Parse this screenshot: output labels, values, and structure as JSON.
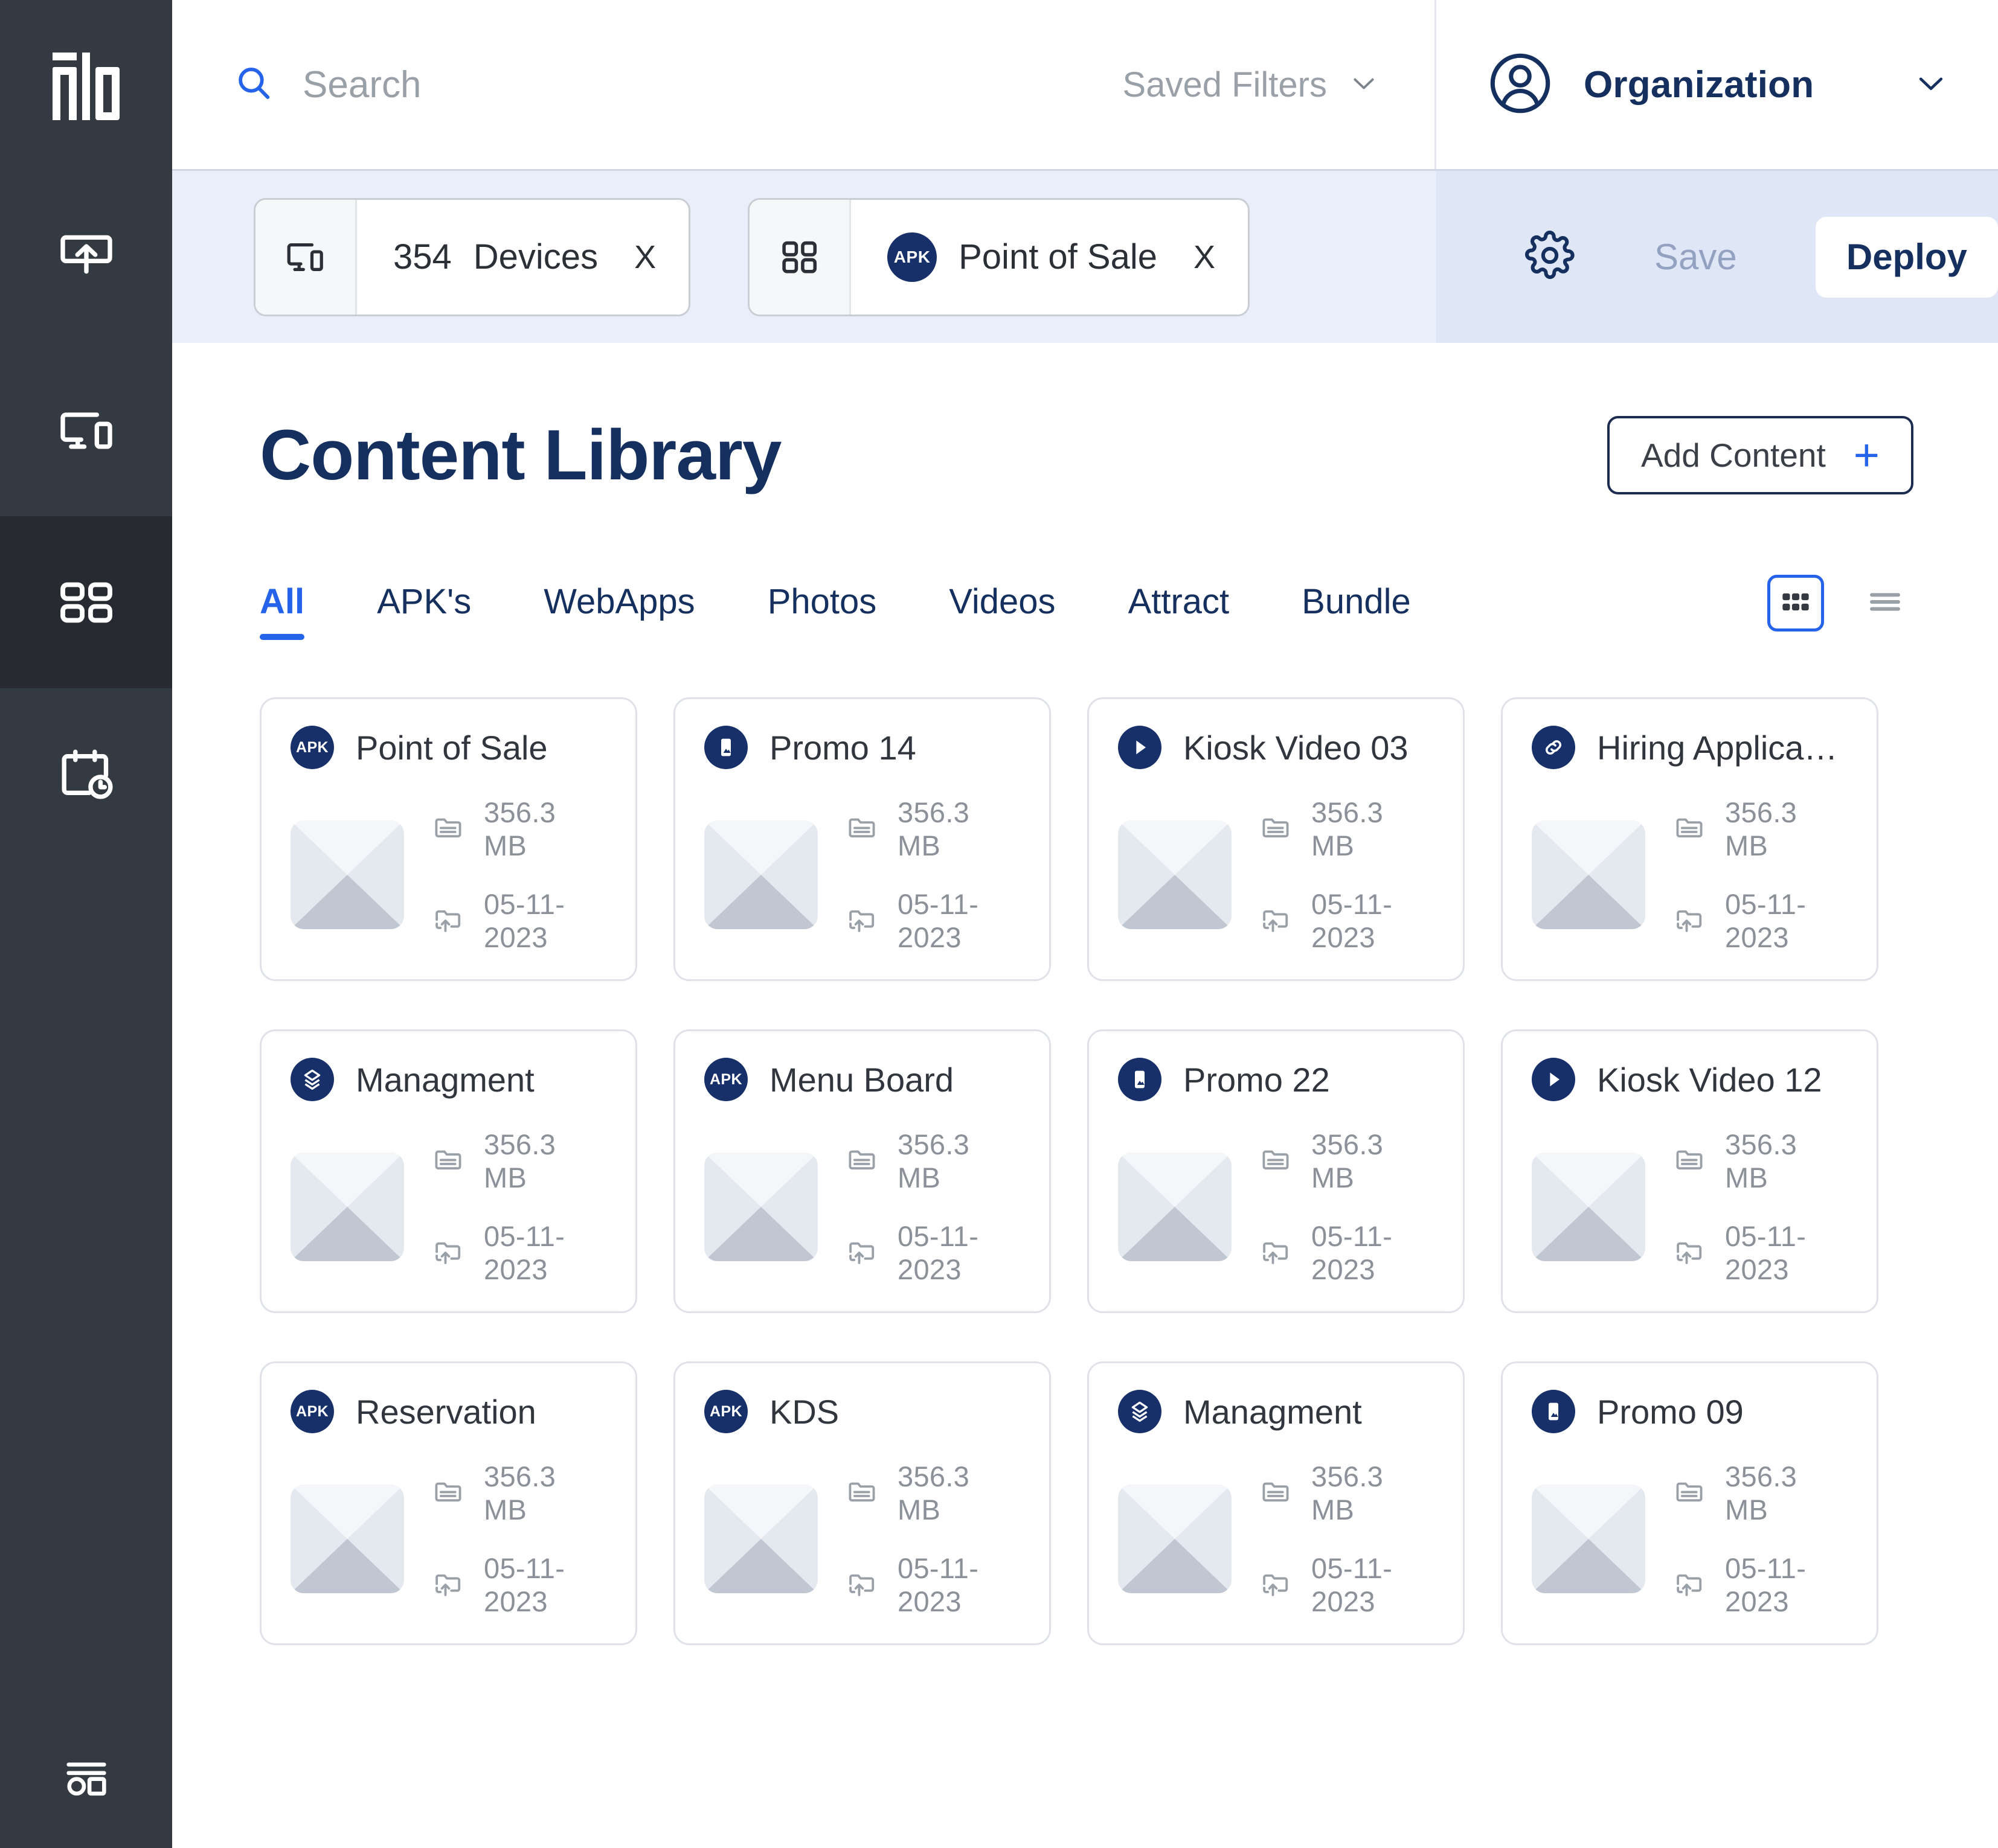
{
  "brand": {
    "logo_text": "elo"
  },
  "sidebar": {
    "items": [
      {
        "name": "deploy",
        "icon": "upload-screen-icon",
        "active": false
      },
      {
        "name": "devices",
        "icon": "devices-icon",
        "active": false
      },
      {
        "name": "content",
        "icon": "grid-icon",
        "active": true
      },
      {
        "name": "schedule",
        "icon": "calendar-clock-icon",
        "active": false
      }
    ],
    "bottom_item": {
      "name": "reports",
      "icon": "layout-list-icon"
    }
  },
  "topbar": {
    "search": {
      "placeholder": "Search",
      "value": "",
      "icon": "search-icon"
    },
    "saved_filters": {
      "label": "Saved Filters",
      "icon": "chevron-down-icon"
    },
    "account": {
      "icon": "user-avatar-icon",
      "label": "Organization",
      "chevron": "chevron-down-icon"
    }
  },
  "filterbar": {
    "chips": [
      {
        "icon": "devices-icon",
        "count": "354",
        "text": "Devices",
        "close": "X",
        "badge": ""
      },
      {
        "icon": "grid-icon",
        "count": "",
        "text": "Point of Sale",
        "close": "X",
        "badge": "APK"
      }
    ],
    "settings_icon": "gear-icon",
    "save_label": "Save",
    "deploy_label": "Deploy"
  },
  "page": {
    "title": "Content Library",
    "add_content_label": "Add Content",
    "add_content_icon": "plus-icon"
  },
  "tabs": [
    {
      "label": "All",
      "active": true
    },
    {
      "label": "APK's",
      "active": false
    },
    {
      "label": "WebApps",
      "active": false
    },
    {
      "label": "Photos",
      "active": false
    },
    {
      "label": "Videos",
      "active": false
    },
    {
      "label": "Attract",
      "active": false
    },
    {
      "label": "Bundle",
      "active": false
    }
  ],
  "view_toggle": [
    {
      "name": "grid-view-button",
      "icon": "grid-view-icon",
      "active": true
    },
    {
      "name": "list-view-button",
      "icon": "list-view-icon",
      "active": false
    }
  ],
  "card_meta_icons": {
    "size": "folder-icon",
    "date": "folder-upload-icon"
  },
  "cards": [
    {
      "title": "Point of Sale",
      "type": "apk",
      "badge": "APK",
      "size": "356.3 MB",
      "date": "05-11-2023"
    },
    {
      "title": "Promo 14",
      "type": "photo",
      "badge": "",
      "size": "356.3 MB",
      "date": "05-11-2023"
    },
    {
      "title": "Kiosk Video 03",
      "type": "video",
      "badge": "",
      "size": "356.3 MB",
      "date": "05-11-2023"
    },
    {
      "title": "Hiring Applica…",
      "type": "link",
      "badge": "",
      "size": "356.3 MB",
      "date": "05-11-2023"
    },
    {
      "title": "Managment",
      "type": "bundle",
      "badge": "",
      "size": "356.3 MB",
      "date": "05-11-2023"
    },
    {
      "title": "Menu Board",
      "type": "apk",
      "badge": "APK",
      "size": "356.3 MB",
      "date": "05-11-2023"
    },
    {
      "title": "Promo 22",
      "type": "photo",
      "badge": "",
      "size": "356.3 MB",
      "date": "05-11-2023"
    },
    {
      "title": "Kiosk Video 12",
      "type": "video",
      "badge": "",
      "size": "356.3 MB",
      "date": "05-11-2023"
    },
    {
      "title": "Reservation",
      "type": "apk",
      "badge": "APK",
      "size": "356.3 MB",
      "date": "05-11-2023"
    },
    {
      "title": "KDS",
      "type": "apk",
      "badge": "APK",
      "size": "356.3 MB",
      "date": "05-11-2023"
    },
    {
      "title": "Managment",
      "type": "bundle",
      "badge": "",
      "size": "356.3 MB",
      "date": "05-11-2023"
    },
    {
      "title": "Promo 09",
      "type": "photo",
      "badge": "",
      "size": "356.3 MB",
      "date": "05-11-2023"
    }
  ],
  "colors": {
    "sidebar_bg": "#343a42",
    "sidebar_active": "#272b31",
    "brand_navy": "#15305f",
    "badge_navy": "#17306a",
    "accent_blue": "#2563eb",
    "filter_bar_bg": "#e9eefa",
    "filter_bar_right_bg": "#dfe7f7",
    "muted_text": "#8b9099"
  }
}
